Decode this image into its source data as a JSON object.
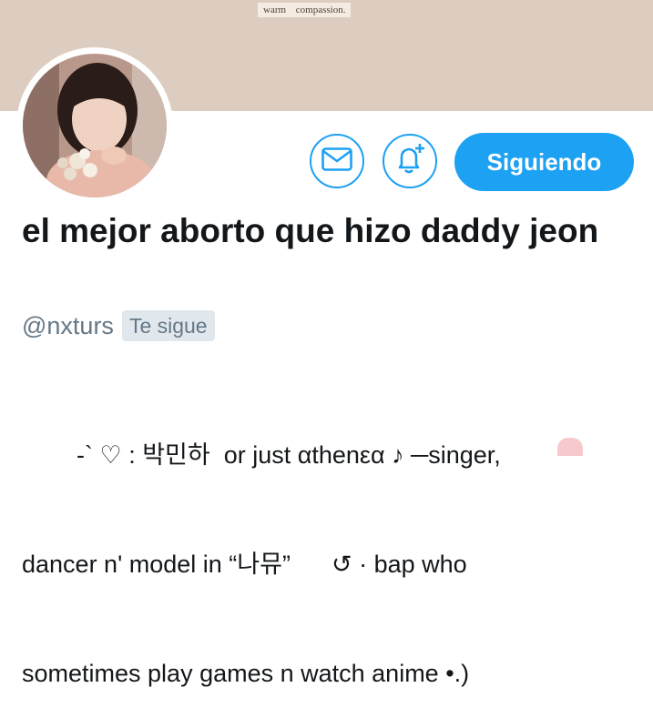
{
  "banner": {
    "caption": "warm  compassion."
  },
  "profile": {
    "display_name": "el mejor aborto que hizo daddy jeon",
    "handle": "@nxturs",
    "follows_you_label": "Te sigue",
    "bio_lines": [
      "        -` ♡ : 박민하  or just αthenεα ♪ ─singer,",
      "dancer n' model in “나뮤”      ↺ · bap who",
      "sometimes play games n watch anime •.)"
    ]
  },
  "actions": {
    "message_icon": "envelope-icon",
    "notify_icon": "bell-plus-icon",
    "follow_label": "Siguiendo"
  },
  "colors": {
    "accent": "#1da1f2",
    "banner": "#dccdc0",
    "muted": "#657786"
  }
}
